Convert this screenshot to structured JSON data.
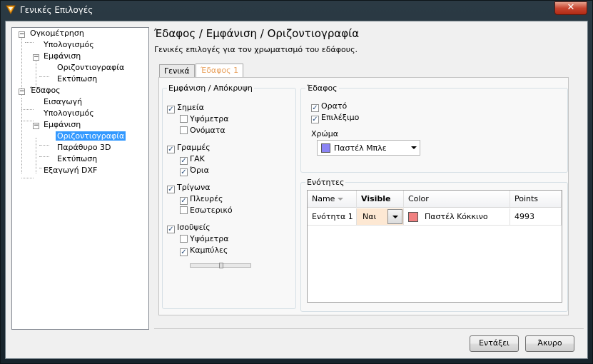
{
  "window": {
    "title": "Γενικές Επιλογές",
    "close_label": "✕"
  },
  "tree": {
    "items": [
      {
        "label": "Ογκομέτρηση"
      },
      {
        "label": "Υπολογισμός"
      },
      {
        "label": "Εμφάνιση"
      },
      {
        "label": "Οριζοντιογραφία"
      },
      {
        "label": "Εκτύπωση"
      },
      {
        "label": "Έδαφος"
      },
      {
        "label": "Εισαγωγή"
      },
      {
        "label": "Υπολογισμός"
      },
      {
        "label": "Εμφάνιση"
      },
      {
        "label": "Οριζοντιογραφία"
      },
      {
        "label": "Παράθυρο 3D"
      },
      {
        "label": "Εκτύπωση"
      },
      {
        "label": "Εξαγωγή DXF"
      }
    ],
    "selected": "Οριζοντιογραφία"
  },
  "header": {
    "title": "Έδαφος / Εμφάνιση / Οριζοντιογραφία",
    "subtitle": "Γενικές επιλογές για τον χρωματισμό του εδάφους."
  },
  "tabs": [
    {
      "label": "Γενικά"
    },
    {
      "label": "Έδαφος 1"
    }
  ],
  "visibility": {
    "title": "Εμφάνιση / Απόκρυψη",
    "items": [
      {
        "label": "Σημεία",
        "checked": true
      },
      {
        "label": "Υψόμετρα",
        "checked": false
      },
      {
        "label": "Ονόματα",
        "checked": false
      },
      {
        "label": "Γραμμές",
        "checked": true
      },
      {
        "label": "ΓΑΚ",
        "checked": true
      },
      {
        "label": "Όρια",
        "checked": true
      },
      {
        "label": "Τρίγωνα",
        "checked": true
      },
      {
        "label": "Πλευρές",
        "checked": true
      },
      {
        "label": "Εσωτερικό",
        "checked": false
      },
      {
        "label": "Ισοϋψείς",
        "checked": true
      },
      {
        "label": "Υψόμετρα",
        "checked": false
      },
      {
        "label": "Καμπύλες",
        "checked": true
      }
    ]
  },
  "terrain": {
    "title": "Έδαφος",
    "visible_label": "Ορατό",
    "selectable_label": "Επιλέξιμο",
    "color_label": "Χρώμα",
    "color_value": "Παστέλ Μπλε",
    "color_hex": "#8b84f5"
  },
  "units": {
    "title": "Ενότητες",
    "columns": [
      "Name",
      "Visible",
      "Color",
      "Points"
    ],
    "rows": [
      {
        "name": "Ενότητα 1",
        "visible": "Ναι",
        "color": "Παστέλ Κόκκινο",
        "color_hex": "#f08080",
        "points": "4993"
      }
    ]
  },
  "buttons": {
    "ok": "Εντάξει",
    "cancel": "Άκυρο"
  },
  "check_glyph": "✓"
}
